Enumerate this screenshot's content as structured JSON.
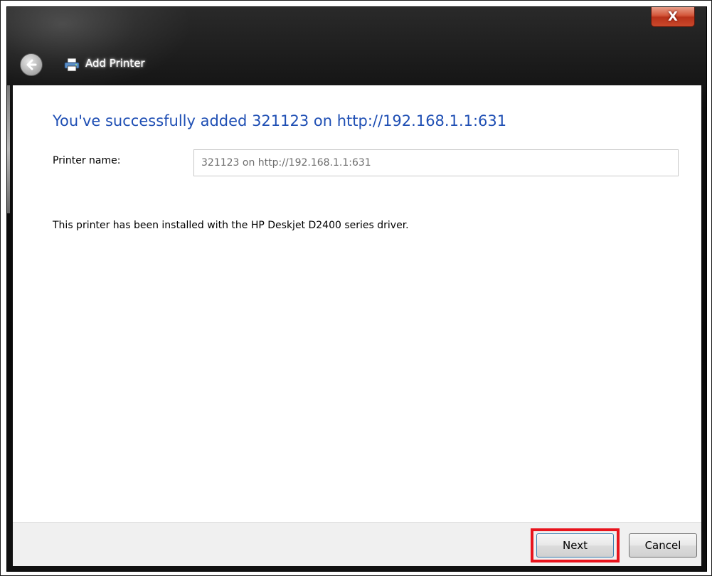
{
  "window": {
    "title": "Add Printer",
    "close_label": "X"
  },
  "content": {
    "heading": "You've successfully added 321123 on http://192.168.1.1:631",
    "printer_name_label": "Printer name:",
    "printer_name_value": "321123 on http://192.168.1.1:631",
    "info_text": "This printer has been installed with the HP Deskjet D2400 series driver."
  },
  "footer": {
    "next_label": "Next",
    "cancel_label": "Cancel"
  },
  "colors": {
    "heading": "#1f4fb4",
    "highlight": "#e8141d",
    "close_button": "#c9482b"
  },
  "icons": {
    "back": "back-arrow-icon",
    "printer": "printer-icon",
    "close": "close-icon"
  }
}
